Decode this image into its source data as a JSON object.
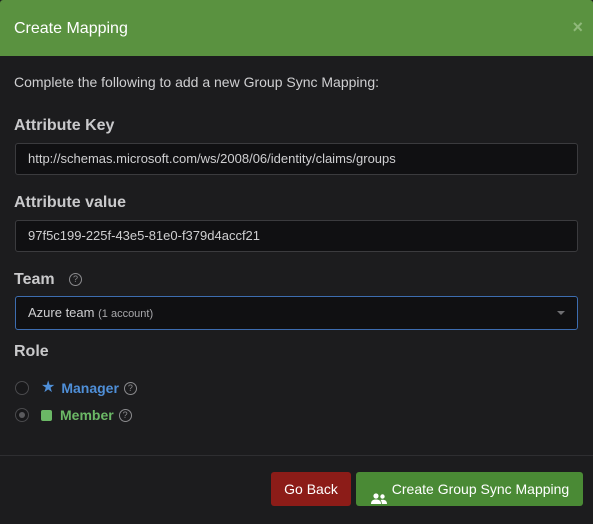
{
  "dialog": {
    "title": "Create Mapping",
    "close_glyph": "×",
    "intro": "Complete the following to add a new Group Sync Mapping:"
  },
  "fields": {
    "attribute_key": {
      "label": "Attribute Key",
      "value": "http://schemas.microsoft.com/ws/2008/06/identity/claims/groups"
    },
    "attribute_value": {
      "label": "Attribute value",
      "value": "97f5c199-225f-43e5-81e0-f379d4accf21"
    },
    "team": {
      "label": "Team",
      "help_glyph": "?",
      "selected": "Azure team",
      "selected_sub": "(1 account)"
    },
    "role": {
      "label": "Role",
      "options": [
        {
          "label": "Manager",
          "icon": "star-icon",
          "color": "#4f8fd8",
          "checked": false
        },
        {
          "label": "Member",
          "icon": "square-icon",
          "color": "#6bb866",
          "checked": true
        }
      ],
      "help_glyph": "?"
    }
  },
  "actions": {
    "back_label": "Go Back",
    "create_label": "Create Group Sync Mapping"
  },
  "colors": {
    "header": "#5a9240",
    "back_button": "#8c1c18",
    "create_button": "#4a8a35",
    "select_border": "#3d6db0"
  }
}
